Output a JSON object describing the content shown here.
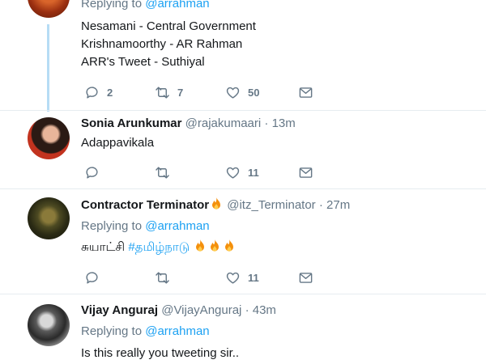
{
  "tweet1": {
    "replying_prefix": "Replying to",
    "replying_handle": "@arrahman",
    "lines": [
      "Nesamani - Central Government",
      "Krishnamoorthy - AR Rahman",
      "ARR's Tweet - Suthiyal"
    ],
    "reply_count": "2",
    "retweet_count": "7",
    "like_count": "50"
  },
  "tweet2": {
    "name": "Sonia Arunkumar",
    "handle": "@rajakumaari",
    "time": "· 13m",
    "text": "Adappavikala",
    "reply_count": "",
    "retweet_count": "",
    "like_count": "11"
  },
  "tweet3": {
    "name": "Contractor Terminator",
    "handle": "@itz_Terminator",
    "time": "· 27m",
    "replying_prefix": "Replying to",
    "replying_handle": "@arrahman",
    "text": "சுயாட்சி",
    "hashtag": "#தமிழ்நாடு",
    "like_count": "11"
  },
  "tweet4": {
    "name": "Vijay Anguraj",
    "handle": "@VijayAnguraj",
    "time": "· 43m",
    "replying_prefix": "Replying to",
    "replying_handle": "@arrahman",
    "text": "Is this really you tweeting sir.."
  },
  "icons": {
    "reply": "reply-icon",
    "retweet": "retweet-icon",
    "like": "heart-icon",
    "dm": "envelope-icon",
    "emoji": "fire-emoji"
  },
  "colors": {
    "link": "#1da1f2",
    "muted": "#657786",
    "thread": "#b6dcf5",
    "fire": "#f4900c"
  }
}
